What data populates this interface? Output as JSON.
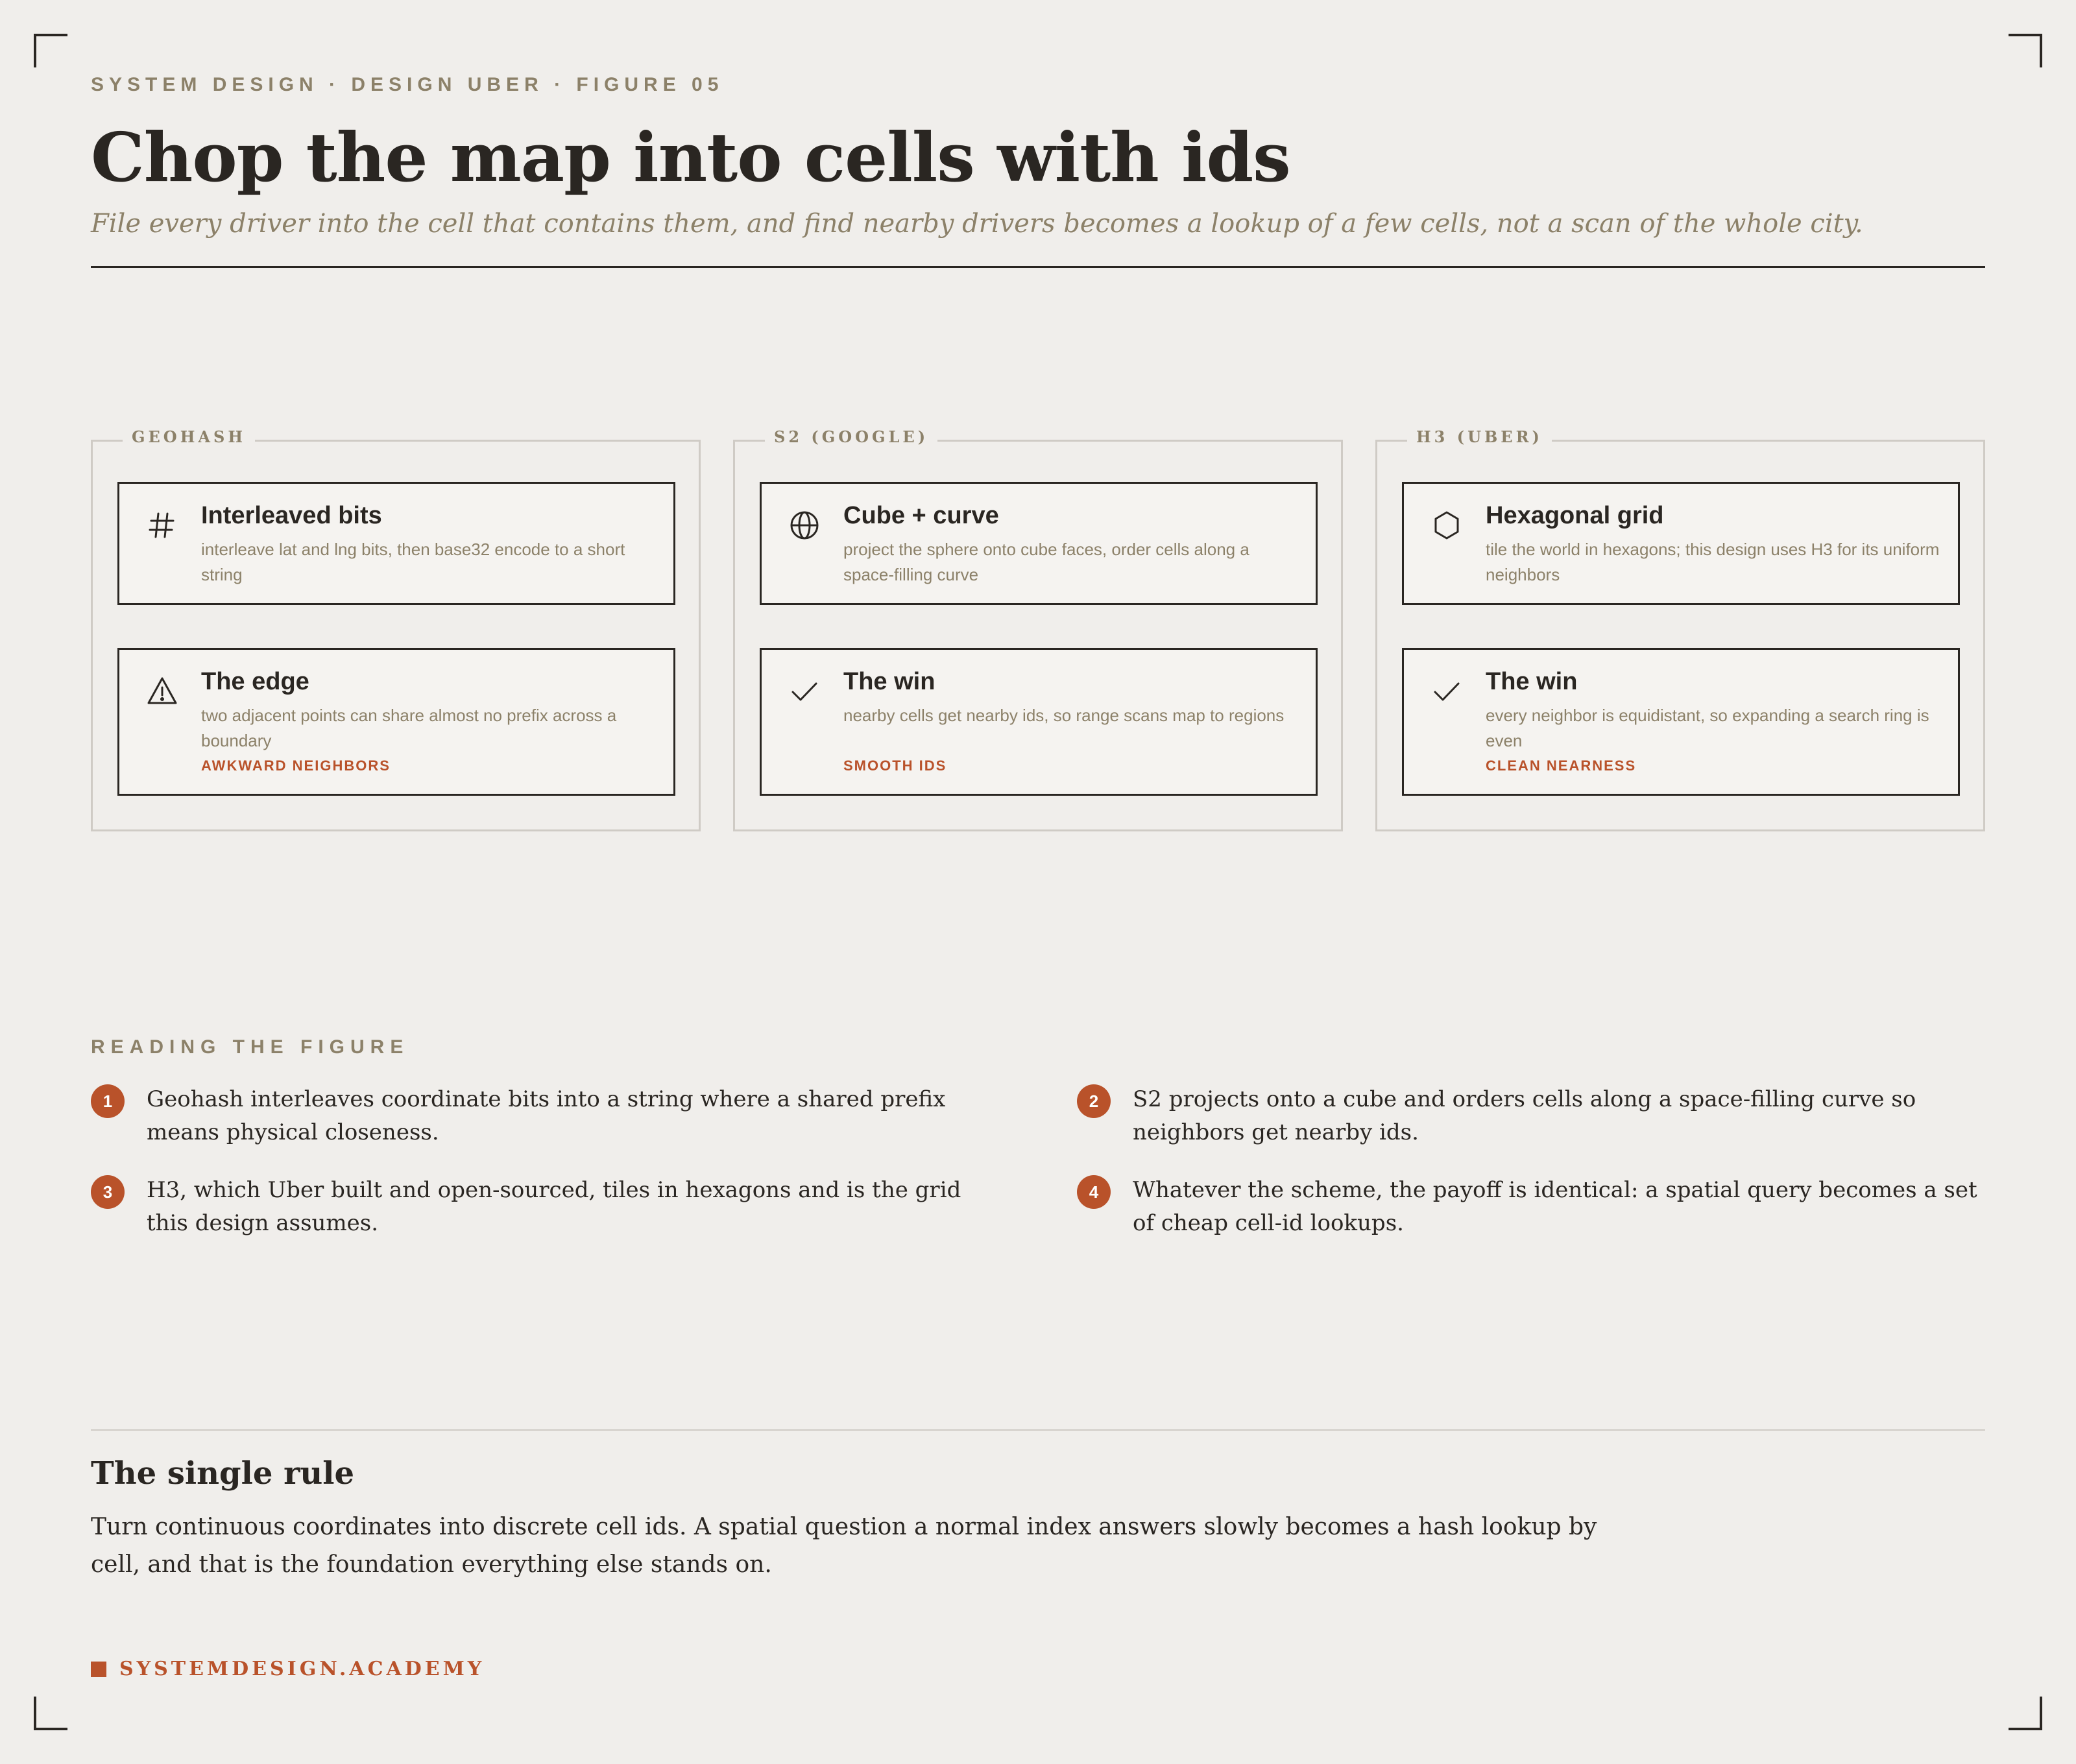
{
  "header": {
    "eyebrow": "SYSTEM DESIGN · DESIGN UBER · FIGURE 05",
    "title": "Chop the map into cells with ids",
    "subtitle": "File every driver into the cell that contains them, and find nearby drivers becomes a lookup of a few cells, not a scan of the whole city."
  },
  "panels": [
    {
      "label": "GEOHASH",
      "top_card": {
        "icon": "hash-icon",
        "title": "Interleaved bits",
        "desc": "interleave lat and lng bits, then base32 encode to a short string"
      },
      "bottom_card": {
        "icon": "warning-icon",
        "title": "The edge",
        "desc": "two adjacent points can share almost no prefix across a boundary",
        "tag": "AWKWARD NEIGHBORS"
      }
    },
    {
      "label": "S2 (GOOGLE)",
      "top_card": {
        "icon": "globe-icon",
        "title": "Cube + curve",
        "desc": "project the sphere onto cube faces, order cells along a space-filling curve"
      },
      "bottom_card": {
        "icon": "check-icon",
        "title": "The win",
        "desc": "nearby cells get nearby ids, so range scans map to regions",
        "tag": "SMOOTH IDS"
      }
    },
    {
      "label": "H3 (UBER)",
      "top_card": {
        "icon": "hexagon-icon",
        "title": "Hexagonal grid",
        "desc": "tile the world in hexagons; this design uses H3 for its uniform neighbors"
      },
      "bottom_card": {
        "icon": "check-icon",
        "title": "The win",
        "desc": "every neighbor is equidistant, so expanding a search ring is even",
        "tag": "CLEAN NEARNESS"
      }
    }
  ],
  "reading": {
    "label": "READING THE FIGURE",
    "notes": [
      {
        "num": "1",
        "text": "Geohash interleaves coordinate bits into a string where a shared prefix means physical closeness."
      },
      {
        "num": "2",
        "text": "S2 projects onto a cube and orders cells along a space-filling curve so neighbors get nearby ids."
      },
      {
        "num": "3",
        "text": "H3, which Uber built and open-sourced, tiles in hexagons and is the grid this design assumes."
      },
      {
        "num": "4",
        "text": "Whatever the scheme, the payoff is identical: a spatial query becomes a set of cheap cell-id lookups."
      }
    ]
  },
  "single_rule": {
    "heading": "The single rule",
    "body": "Turn continuous coordinates into discrete cell ids. A spatial question a normal index answers slowly becomes a hash lookup by cell, and that is the foundation everything else stands on."
  },
  "brand": "SYSTEMDESIGN.ACADEMY",
  "colors": {
    "background": "#f0eeeb",
    "ink": "#2a2622",
    "muted": "#8c8169",
    "accent": "#b9522a",
    "panel_border": "#cfcbc5"
  }
}
